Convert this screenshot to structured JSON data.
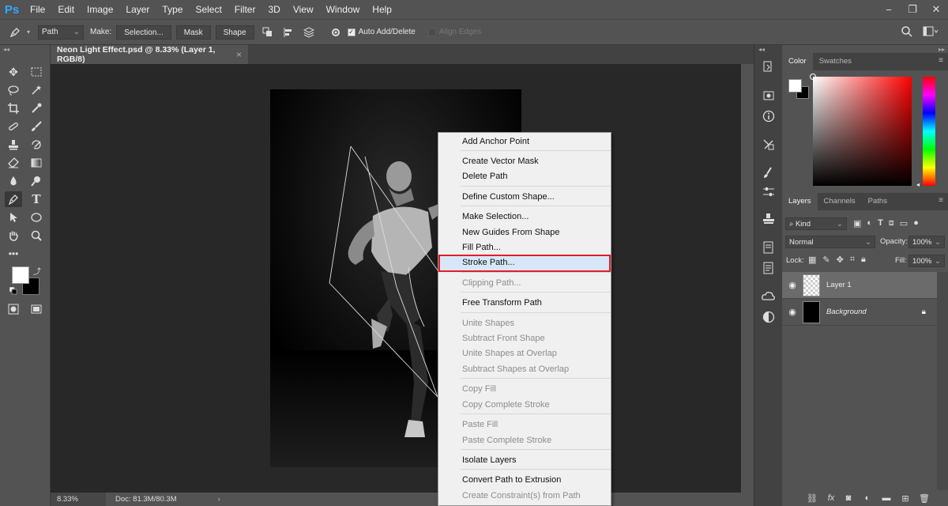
{
  "app": {
    "logo": "Ps"
  },
  "menu": [
    "File",
    "Edit",
    "Image",
    "Layer",
    "Type",
    "Select",
    "Filter",
    "3D",
    "View",
    "Window",
    "Help"
  ],
  "window_controls": [
    "−",
    "❐",
    "✕"
  ],
  "options": {
    "mode_value": "Path",
    "make_label": "Make:",
    "selection_btn": "Selection...",
    "mask_btn": "Mask",
    "shape_btn": "Shape",
    "auto_add_delete": "Auto Add/Delete",
    "align_edges": "Align Edges"
  },
  "document": {
    "tab_title": "Neon Light Effect.psd @ 8.33% (Layer 1, RGB/8)",
    "tab_close": "×",
    "zoom": "8.33%",
    "doc_size": "Doc: 81.3M/80.3M"
  },
  "context_menu": {
    "items": [
      {
        "label": "Add Anchor Point",
        "disabled": false
      },
      {
        "label": "Create Vector Mask",
        "disabled": false
      },
      {
        "label": "Delete Path",
        "disabled": false
      },
      {
        "label": "Define Custom Shape...",
        "disabled": false
      },
      {
        "label": "Make Selection...",
        "disabled": false
      },
      {
        "label": "New Guides From Shape",
        "disabled": false
      },
      {
        "label": "Fill Path...",
        "disabled": false
      },
      {
        "label": "Stroke Path...",
        "disabled": false
      },
      {
        "label": "Clipping Path...",
        "disabled": true
      },
      {
        "label": "Free Transform Path",
        "disabled": false
      },
      {
        "label": "Unite Shapes",
        "disabled": true
      },
      {
        "label": "Subtract Front Shape",
        "disabled": true
      },
      {
        "label": "Unite Shapes at Overlap",
        "disabled": true
      },
      {
        "label": "Subtract Shapes at Overlap",
        "disabled": true
      },
      {
        "label": "Copy Fill",
        "disabled": true
      },
      {
        "label": "Copy Complete Stroke",
        "disabled": true
      },
      {
        "label": "Paste Fill",
        "disabled": true
      },
      {
        "label": "Paste Complete Stroke",
        "disabled": true
      },
      {
        "label": "Isolate Layers",
        "disabled": false
      },
      {
        "label": "Convert Path to Extrusion",
        "disabled": false
      },
      {
        "label": "Create Constraint(s) from Path",
        "disabled": true
      }
    ],
    "highlighted": "Stroke Path..."
  },
  "color_panel": {
    "tabs": [
      "Color",
      "Swatches"
    ],
    "foreground": "#ffffff",
    "background": "#000000",
    "hue": "#ff0000"
  },
  "layers_panel": {
    "tabs": [
      "Layers",
      "Channels",
      "Paths"
    ],
    "kind_label": "Kind",
    "blend_mode": "Normal",
    "opacity_label": "Opacity:",
    "opacity_value": "100%",
    "lock_label": "Lock:",
    "fill_label": "Fill:",
    "fill_value": "100%",
    "layers": [
      {
        "name": "Layer 1",
        "selected": true,
        "locked": false
      },
      {
        "name": "Background",
        "selected": false,
        "locked": true
      }
    ]
  },
  "colors": {
    "highlight_border": "#e01e2a",
    "highlight_fill": "#d8e7f7",
    "ps_blue": "#31a8ff"
  }
}
